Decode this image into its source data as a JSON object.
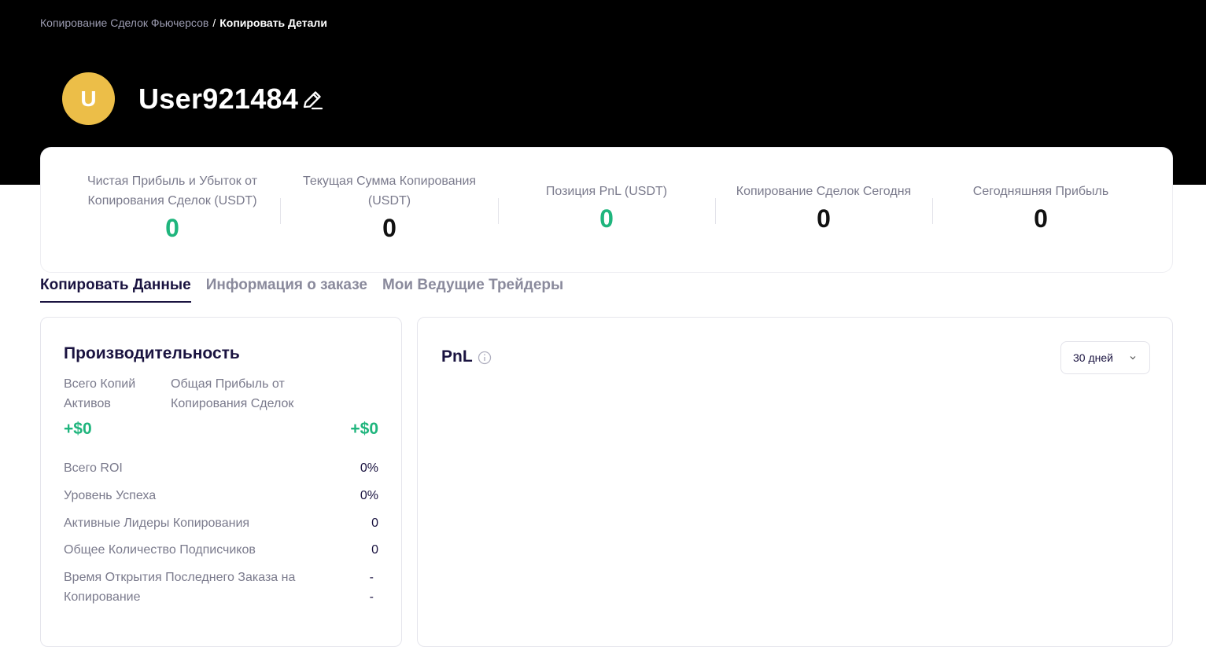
{
  "breadcrumb": {
    "parent": "Копирование Сделок Фьючерсов",
    "separator": "/",
    "current": "Копировать Детали"
  },
  "profile": {
    "avatar_letter": "U",
    "avatar_color": "#ecbe48",
    "username": "User921484",
    "edit_icon": "pencil-edit-icon"
  },
  "stats": [
    {
      "label": "Чистая Прибыль и Убыток от Копирования Сделок (USDT)",
      "value": "0",
      "color": "#1fb57d"
    },
    {
      "label": "Текущая Сумма Копирования (USDT)",
      "value": "0",
      "color": "#111111"
    },
    {
      "label": "Позиция PnL (USDT)",
      "value": "0",
      "color": "#1fb57d"
    },
    {
      "label": "Копирование Сделок Сегодня",
      "value": "0",
      "color": "#111111"
    },
    {
      "label": "Сегодняшняя Прибыль",
      "value": "0",
      "color": "#111111"
    }
  ],
  "tabs": [
    {
      "label": "Копировать Данные",
      "active": true
    },
    {
      "label": "Информация о заказе",
      "active": false
    },
    {
      "label": "Мои Ведущие Трейдеры",
      "active": false
    }
  ],
  "performance": {
    "title": "Производительность",
    "total_assets_label": "Всего Копий Активов",
    "total_assets_value": "+$0",
    "total_profit_label": "Общая Прибыль от Копирования Сделок",
    "total_profit_value": "+$0",
    "rows": [
      {
        "label": "Всего ROI",
        "value": "0%"
      },
      {
        "label": "Уровень Успеха",
        "value": "0%"
      },
      {
        "label": "Активные Лидеры Копирования",
        "value": "0"
      },
      {
        "label": "Общее Количество Подписчиков",
        "value": "0"
      },
      {
        "label": "Время Открытия Последнего Заказа на Копирование",
        "value": "-",
        "value2": "-"
      }
    ]
  },
  "pnl": {
    "title": "PnL",
    "info_icon": "info-icon",
    "range_selected": "30 дней"
  },
  "colors": {
    "accent_green": "#1fb57d",
    "hero_bg": "#000000",
    "text_dark": "#1a1340",
    "text_muted": "#7a7a8c"
  }
}
